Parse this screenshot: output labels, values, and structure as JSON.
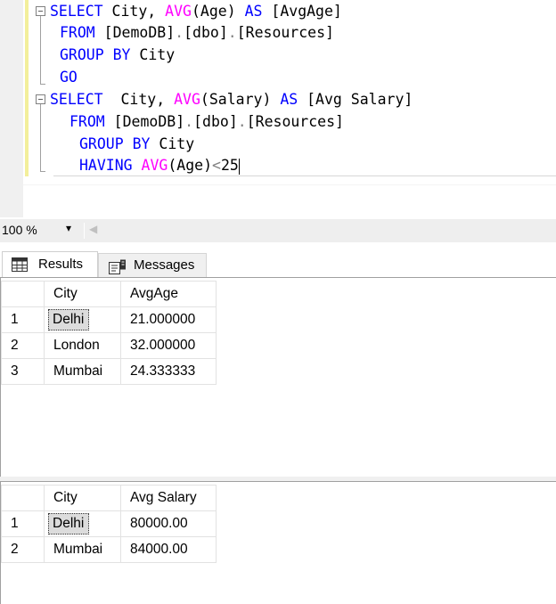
{
  "editor": {
    "line1": {
      "kw1": "SELECT",
      "t1": " City, ",
      "fn1": "AVG",
      "t2": "(Age) ",
      "kw2": "AS",
      "t3": " [AvgAge]"
    },
    "line2": {
      "kw1": "FROM",
      "t1": " [DemoDB]",
      "p1": ".",
      "t2": "[dbo]",
      "p2": ".",
      "t3": "[Resources]"
    },
    "line3": {
      "kw1": "GROUP",
      "s1": " ",
      "kw2": "BY",
      "t1": " City"
    },
    "line4": {
      "kw1": "GO"
    },
    "line5": {
      "kw1": "SELECT",
      "t1": "  City, ",
      "fn1": "AVG",
      "t2": "(Salary) ",
      "kw2": "AS",
      "t3": " [Avg Salary]"
    },
    "line6": {
      "kw1": "FROM",
      "t1": " [DemoDB]",
      "p1": ".",
      "t2": "[dbo]",
      "p2": ".",
      "t3": "[Resources]"
    },
    "line7": {
      "kw1": "GROUP",
      "s1": " ",
      "kw2": "BY",
      "t1": " City"
    },
    "line8": {
      "kw1": "HAVING",
      "s1": " ",
      "fn1": "AVG",
      "t1": "(Age)",
      "op": "<",
      "t2": "25"
    }
  },
  "zoom": {
    "value": "100 %",
    "arrow": "▾",
    "scroll_left": "◀"
  },
  "tabs": {
    "results": "Results",
    "messages": "Messages"
  },
  "grid1": {
    "headers": [
      "City",
      "AvgAge"
    ],
    "rows": [
      {
        "num": "1",
        "city": "Delhi",
        "value": "21.000000"
      },
      {
        "num": "2",
        "city": "London",
        "value": "32.000000"
      },
      {
        "num": "3",
        "city": "Mumbai",
        "value": "24.333333"
      }
    ]
  },
  "grid2": {
    "headers": [
      "City",
      "Avg Salary"
    ],
    "rows": [
      {
        "num": "1",
        "city": "Delhi",
        "value": "80000.00"
      },
      {
        "num": "2",
        "city": "Mumbai",
        "value": "84000.00"
      }
    ]
  },
  "colors": {
    "keyword": "#0000ff",
    "function": "#ff00ff",
    "punctuation": "#808080",
    "change_bar": "#f3ef9b"
  }
}
